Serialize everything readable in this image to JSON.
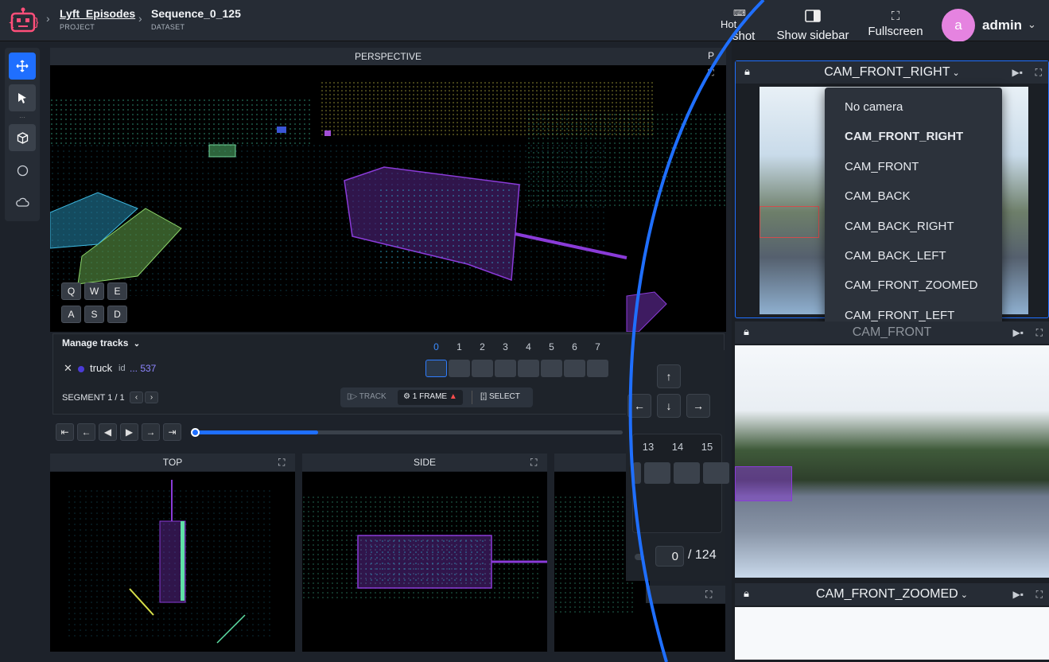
{
  "header": {
    "project_name": "Lyft_Episodes",
    "project_label": "PROJECT",
    "dataset_name": "Sequence_0_125",
    "dataset_label": "DATASET",
    "hotkeys_partial": "Hot",
    "screenshot_partial": "shot",
    "show_sidebar_label": "Show sidebar",
    "fullscreen_label": "Fullscreen",
    "avatar_letter": "a",
    "user_name": "admin"
  },
  "perspective": {
    "title": "PERSPECTIVE",
    "title_partial": "P",
    "keys_row1": [
      "Q",
      "W",
      "E"
    ],
    "keys_row2": [
      "A",
      "S",
      "D"
    ]
  },
  "tracks": {
    "manage_label": "Manage tracks",
    "track_name": "truck",
    "track_id_label": "id",
    "track_id_value": "... 537",
    "segment_label": "SEGMENT 1 / 1",
    "frames_left": [
      "0",
      "1",
      "2",
      "3",
      "4",
      "5",
      "6",
      "7"
    ],
    "frames_right": [
      "13",
      "14",
      "15"
    ],
    "track_btn": "TRACK",
    "frame_btn": "1 FRAME",
    "select_btn": "SELECT"
  },
  "playback": {
    "current_frame": "0",
    "total_frames": "/ 124",
    "progress": 0.29
  },
  "views": {
    "top": "TOP",
    "side": "SIDE"
  },
  "cameras": {
    "cam1": "CAM_FRONT_RIGHT",
    "cam2_partial": "CAM_FRONT",
    "cam3": "CAM_FRONT_ZOOMED",
    "menu_items": [
      "No camera",
      "CAM_FRONT_RIGHT",
      "CAM_FRONT",
      "CAM_BACK",
      "CAM_BACK_RIGHT",
      "CAM_BACK_LEFT",
      "CAM_FRONT_ZOOMED",
      "CAM_FRONT_LEFT"
    ],
    "menu_selected": "CAM_FRONT_RIGHT"
  },
  "colors": {
    "accent": "#1f6fff",
    "track_color": "#4b3bd6",
    "avatar": "#e583e0",
    "box_purple": "#8a3bd8"
  }
}
